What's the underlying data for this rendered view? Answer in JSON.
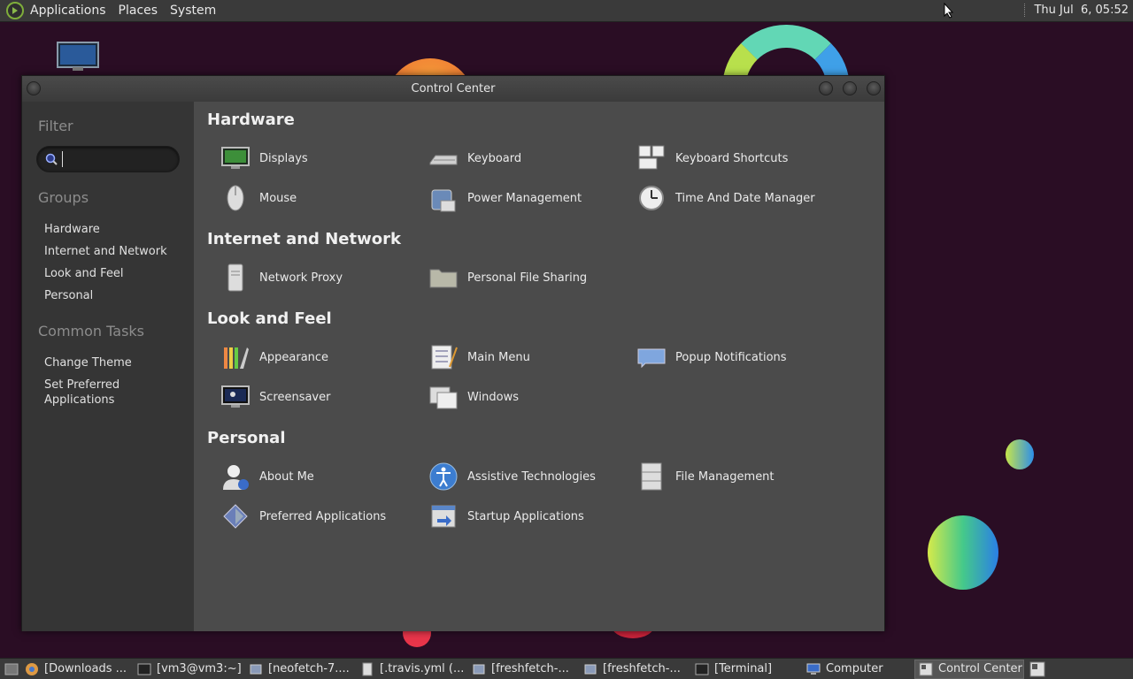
{
  "top_panel": {
    "menus": [
      "Applications",
      "Places",
      "System"
    ],
    "clock": "Thu Jul  6, 05:52"
  },
  "window": {
    "title": "Control Center"
  },
  "sidebar": {
    "filter_heading": "Filter",
    "search_placeholder": "",
    "groups_heading": "Groups",
    "groups": [
      "Hardware",
      "Internet and Network",
      "Look and Feel",
      "Personal"
    ],
    "tasks_heading": "Common Tasks",
    "tasks": [
      "Change Theme",
      "Set Preferred\nApplications"
    ]
  },
  "main": {
    "sections": [
      {
        "title": "Hardware",
        "items": [
          {
            "label": "Displays",
            "icon": "display-icon"
          },
          {
            "label": "Keyboard",
            "icon": "keyboard-icon"
          },
          {
            "label": "Keyboard Shortcuts",
            "icon": "keyboard-shortcuts-icon"
          },
          {
            "label": "Mouse",
            "icon": "mouse-icon"
          },
          {
            "label": "Power Management",
            "icon": "power-management-icon"
          },
          {
            "label": "Time And Date Manager",
            "icon": "clock-icon"
          }
        ]
      },
      {
        "title": "Internet and Network",
        "items": [
          {
            "label": "Network Proxy",
            "icon": "network-proxy-icon"
          },
          {
            "label": "Personal File Sharing",
            "icon": "folder-share-icon"
          }
        ]
      },
      {
        "title": "Look and Feel",
        "items": [
          {
            "label": "Appearance",
            "icon": "appearance-icon"
          },
          {
            "label": "Main Menu",
            "icon": "main-menu-icon"
          },
          {
            "label": "Popup Notifications",
            "icon": "notification-icon"
          },
          {
            "label": "Screensaver",
            "icon": "screensaver-icon"
          },
          {
            "label": "Windows",
            "icon": "windows-icon"
          }
        ]
      },
      {
        "title": "Personal",
        "items": [
          {
            "label": "About Me",
            "icon": "about-me-icon"
          },
          {
            "label": "Assistive Technologies",
            "icon": "accessibility-icon"
          },
          {
            "label": "File Management",
            "icon": "file-management-icon"
          },
          {
            "label": "Preferred Applications",
            "icon": "preferred-apps-icon"
          },
          {
            "label": "Startup Applications",
            "icon": "startup-apps-icon"
          }
        ]
      }
    ]
  },
  "taskbar": {
    "tasks": [
      {
        "label": "[Downloads ...",
        "icon": "chrome-icon"
      },
      {
        "label": "[vm3@vm3:~]",
        "icon": "terminal-icon"
      },
      {
        "label": "[neofetch-7....",
        "icon": "file-manager-icon"
      },
      {
        "label": "[.travis.yml (...",
        "icon": "text-editor-icon"
      },
      {
        "label": "[freshfetch-...",
        "icon": "file-manager-icon"
      },
      {
        "label": "[freshfetch-...",
        "icon": "file-manager-icon"
      },
      {
        "label": "[Terminal]",
        "icon": "terminal-icon"
      },
      {
        "label": "Computer",
        "icon": "computer-icon"
      },
      {
        "label": "Control Center",
        "icon": "control-center-icon"
      }
    ]
  },
  "colors": {
    "desktop_bg": "#2a0d24",
    "panel_bg": "#3a3a3a",
    "sidebar_bg": "#353535",
    "main_bg": "#4b4b4b",
    "accent_green": "#7fae3b"
  }
}
